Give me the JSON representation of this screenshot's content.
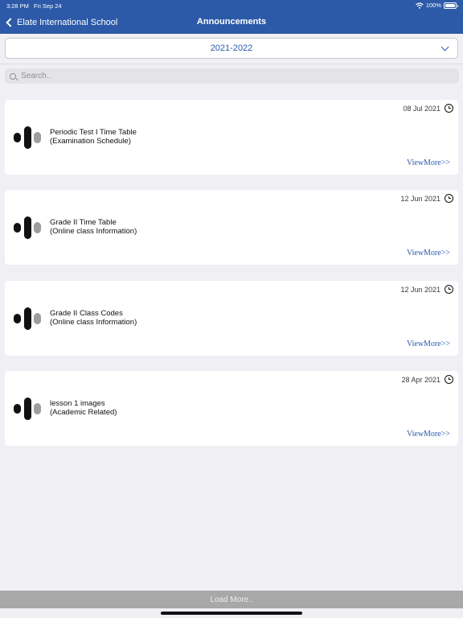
{
  "status_bar": {
    "time": "3:28 PM",
    "date": "Fri Sep 24",
    "battery": "100%"
  },
  "nav": {
    "back_label": "Elate International School",
    "title": "Announcements"
  },
  "year_selector": {
    "value": "2021-2022"
  },
  "search": {
    "placeholder": "Search.."
  },
  "announcements": [
    {
      "date": "08 Jul 2021",
      "title": "Periodic Test I Time Table",
      "category": "(Examination Schedule)",
      "link": "ViewMore>>"
    },
    {
      "date": "12 Jun 2021",
      "title": "Grade II Time Table",
      "category": "(Online class Information)",
      "link": "ViewMore>>"
    },
    {
      "date": "12 Jun 2021",
      "title": "Grade II Class Codes",
      "category": "(Online class Information)",
      "link": "ViewMore>>"
    },
    {
      "date": "28 Apr 2021",
      "title": "lesson 1 images",
      "category": "(Academic Related)",
      "link": "ViewMore>>"
    }
  ],
  "load_more": "Load More..",
  "icons": {
    "back": "chevron-left-icon",
    "dropdown": "chevron-down-icon",
    "search": "search-icon",
    "clock": "clock-icon",
    "wifi": "wifi-icon",
    "battery": "battery-icon",
    "logo": "school-logo-icon"
  },
  "colors": {
    "nav_bar": "#2c5aa8",
    "accent": "#2c5aa8",
    "load_more_bar": "#a8a8a8",
    "background": "#f0f0f4"
  }
}
